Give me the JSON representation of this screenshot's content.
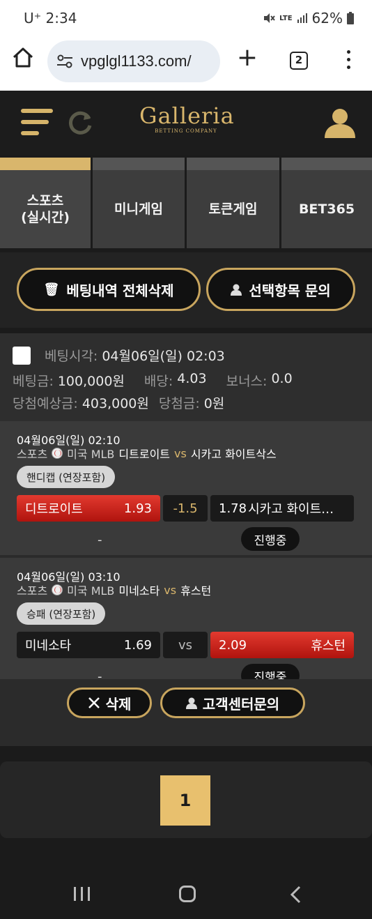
{
  "status_bar": {
    "time": "U⁺ 2:34",
    "network": "LTE",
    "battery": "62%"
  },
  "browser": {
    "url": "vpglgl1133.com/",
    "tab_count": "2",
    "plus": "+"
  },
  "header": {
    "logo_name": "Galleria",
    "logo_sub": "BETTING COMPANY"
  },
  "category_tabs": [
    {
      "label": "스포츠\n(실시간)",
      "active": true
    },
    {
      "label": "미니게임",
      "active": false
    },
    {
      "label": "토큰게임",
      "active": false
    },
    {
      "label": "BET365",
      "active": false
    }
  ],
  "actions": {
    "delete_all": "베팅내역 전체삭제",
    "inquire_selected": "선택항목 문의"
  },
  "bet": {
    "time_label": "베팅시각:",
    "time_value": "04월06일(일) 02:03",
    "amount_label": "베팅금:",
    "amount_value": "100,000원",
    "odds_label": "배당:",
    "odds_value": "4.03",
    "bonus_label": "보너스:",
    "bonus_value": "0.0",
    "expected_label": "당첨예상금:",
    "expected_value": "403,000원",
    "win_label": "당첨금:",
    "win_value": "0원"
  },
  "matches": [
    {
      "date": "04월06일(일) 02:10",
      "sport": "스포츠",
      "league": "미국 MLB",
      "home": "디트로이트",
      "vs": "vs",
      "away": "시카고 화이트삭스",
      "market": "핸디캡 (연장포함)",
      "home_label": "디트로이트",
      "home_odds": "1.93",
      "mid": "-1.5",
      "away_odds": "1.78",
      "away_label": "시카고 화이트…",
      "result": "-",
      "status": "진행중"
    },
    {
      "date": "04월06일(일) 03:10",
      "sport": "스포츠",
      "league": "미국 MLB",
      "home": "미네소타",
      "vs": "vs",
      "away": "휴스턴",
      "market": "승패 (연장포함)",
      "home_label": "미네소타",
      "home_odds": "1.69",
      "mid": "vs",
      "away_odds": "2.09",
      "away_label": "휴스턴",
      "result": "-",
      "status": "진행중"
    }
  ],
  "footer_buttons": {
    "delete": "삭제",
    "support": "고객센터문의"
  },
  "pagination": {
    "current": "1"
  },
  "colors": {
    "gold": "#d9b66c",
    "red": "#d02a20",
    "background": "#1b1b1b"
  }
}
